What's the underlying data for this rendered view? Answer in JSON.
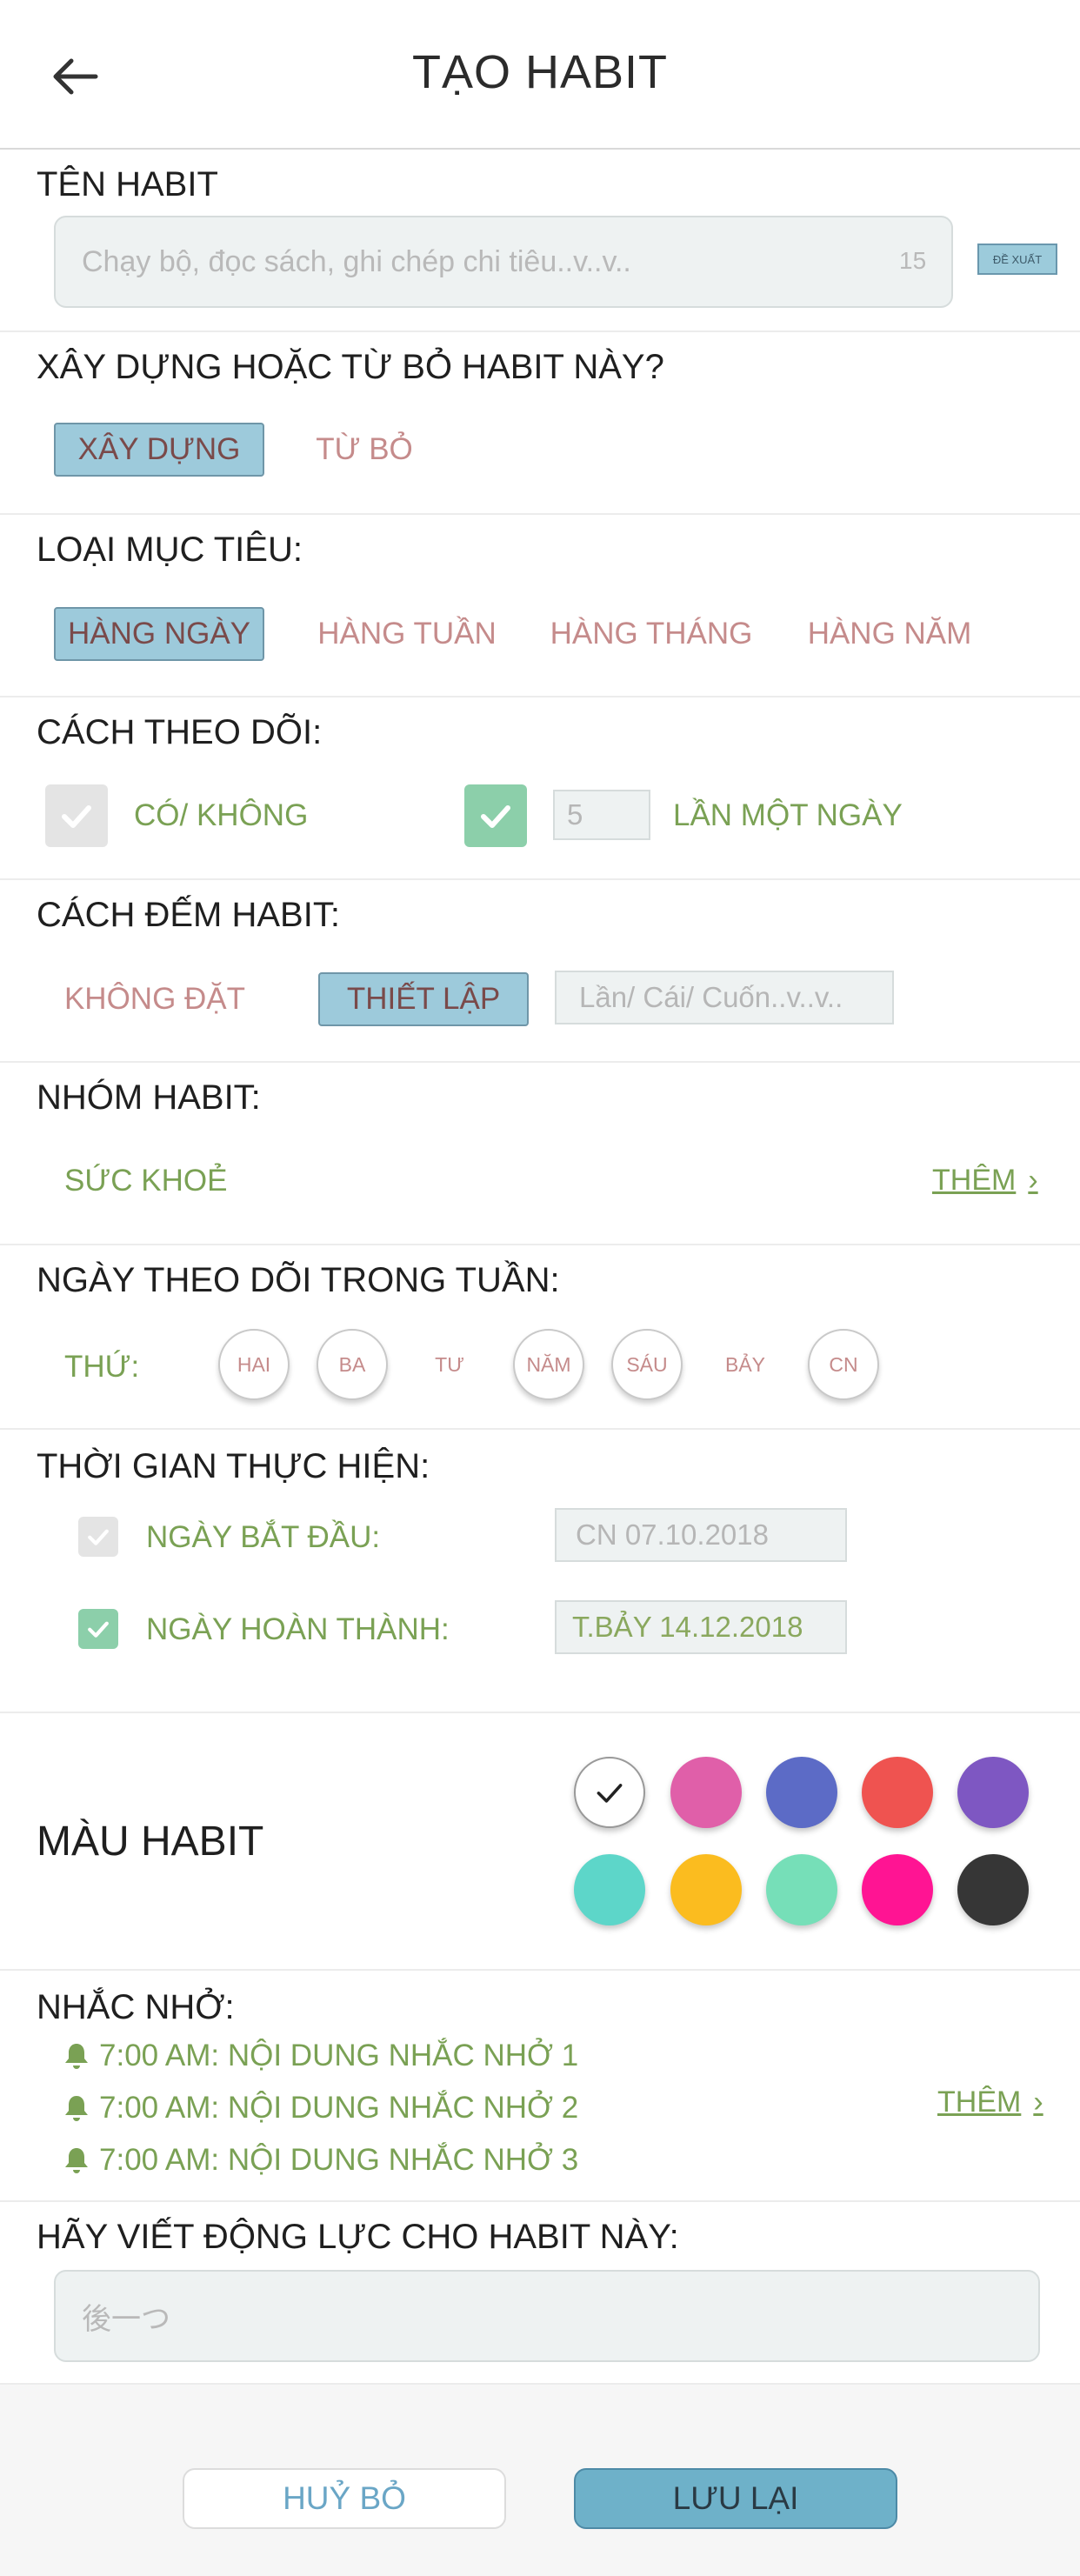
{
  "header": {
    "title": "TẠO HABIT",
    "back_icon": "arrow-left-icon"
  },
  "habit_name": {
    "title": "TÊN HABIT",
    "placeholder": "Chạy bộ, đọc sách, ghi chép chi tiêu..v..v..",
    "counter": "15",
    "suggest_label": "ĐỀ XUẤT"
  },
  "build_or_quit": {
    "title": "XÂY DỰNG HOẶC TỪ BỎ HABIT NÀY?",
    "options": [
      "XÂY DỰNG",
      "TỪ BỎ"
    ],
    "selected": "XÂY DỰNG"
  },
  "goal_type": {
    "title": "LOẠI MỤC TIÊU:",
    "options": [
      "HÀNG NGÀY",
      "HÀNG TUẦN",
      "HÀNG THÁNG",
      "HÀNG NĂM"
    ],
    "selected": "HÀNG NGÀY"
  },
  "tracking": {
    "title": "CÁCH THEO DÕI:",
    "yes_no_label": "CÓ/ KHÔNG",
    "yes_no_checked": false,
    "times_value": "5",
    "times_label": "LẦN MỘT NGÀY",
    "times_checked": true
  },
  "counting": {
    "title": "CÁCH ĐẾM HABIT:",
    "no_set_label": "KHÔNG ĐẶT",
    "set_label": "THIẾT LẬP",
    "selected": "THIẾT LẬP",
    "unit_placeholder": "Lần/ Cái/ Cuốn..v..v.."
  },
  "group": {
    "title": "NHÓM HABIT:",
    "value": "SỨC KHOẺ",
    "add_label": "THÊM"
  },
  "weekdays": {
    "title": "NGÀY THEO DÕI TRONG TUẦN:",
    "prefix": "THỨ:",
    "days": [
      "HAI",
      "BA",
      "TƯ",
      "NĂM",
      "SÁU",
      "BẢY",
      "CN"
    ],
    "selected": [
      "HAI",
      "BA",
      "NĂM",
      "SÁU",
      "CN"
    ]
  },
  "duration": {
    "title": "THỜI GIAN THỰC HIỆN:",
    "start_label": "NGÀY BẮT ĐẦU:",
    "start_value": "CN 07.10.2018",
    "start_checked": false,
    "end_label": "NGÀY HOÀN THÀNH:",
    "end_value": "T.BẢY 14.12.2018",
    "end_checked": true
  },
  "color": {
    "title": "MÀU HABIT",
    "swatches": [
      "#ffffff",
      "#e05fa9",
      "#5c6bc6",
      "#ef5350",
      "#7e57c2",
      "#5dd6c9",
      "#fbbc1f",
      "#76dfb8",
      "#ff1493",
      "#363636"
    ],
    "selected_index": 0
  },
  "reminders": {
    "title": "NHẮC NHỞ:",
    "items": [
      "7:00 AM: NỘI DUNG NHẮC NHỞ 1",
      "7:00 AM: NỘI DUNG NHẮC NHỞ 2",
      "7:00 AM: NỘI DUNG NHẮC NHỞ 3"
    ],
    "add_label": "THÊM"
  },
  "motivation": {
    "title": "HÃY VIẾT ĐỘNG LỰC CHO HABIT NÀY:",
    "placeholder": "後一つ"
  },
  "footer": {
    "cancel_label": "HUỶ BỎ",
    "save_label": "LƯU LẠI"
  },
  "colors": {
    "accent_blue": "#9dcadb",
    "label_green": "#7aa154",
    "unselected_option": "#c58b8b",
    "check_green": "#8ccfaa"
  }
}
